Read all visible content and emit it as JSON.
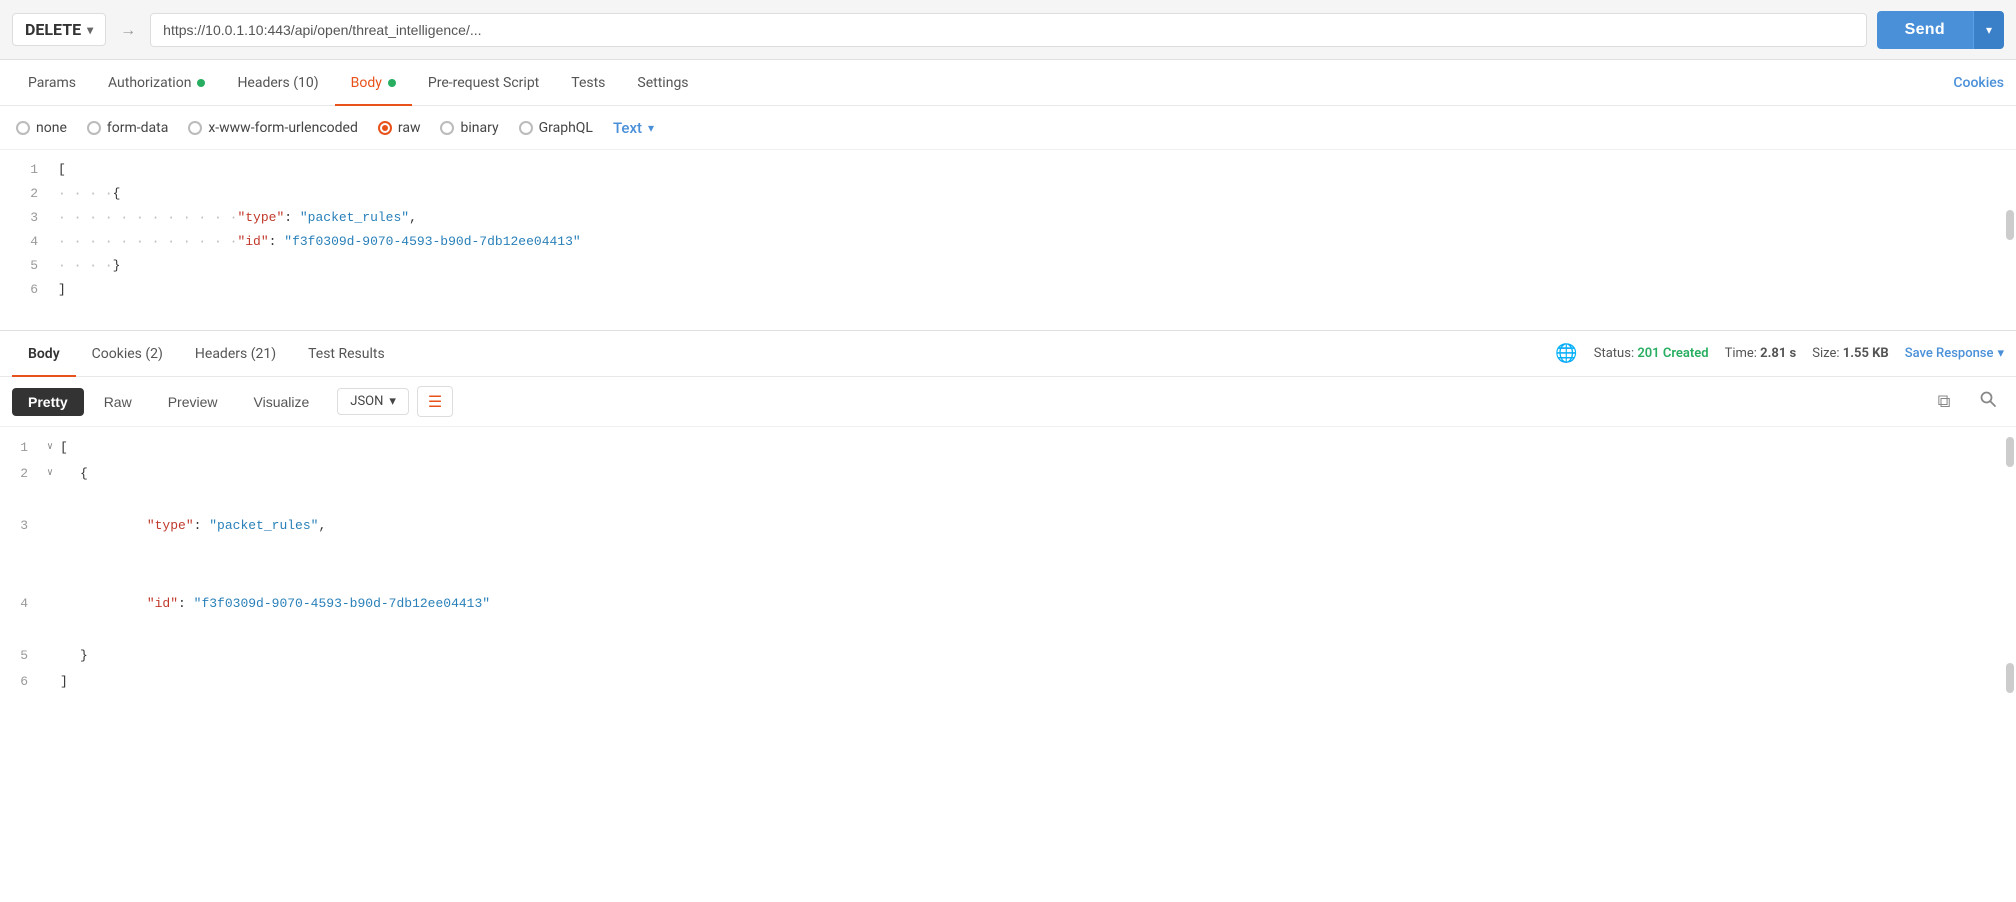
{
  "url_bar": {
    "method": "DELETE",
    "url": "https://10.0.1.10:443/api/open/threat_intelligence/...",
    "send_label": "Send"
  },
  "tabs": {
    "items": [
      {
        "label": "Params",
        "active": false,
        "has_dot": false
      },
      {
        "label": "Authorization",
        "active": false,
        "has_dot": true,
        "dot_color": "green"
      },
      {
        "label": "Headers (10)",
        "active": false,
        "has_dot": false
      },
      {
        "label": "Body",
        "active": true,
        "has_dot": true,
        "dot_color": "green"
      },
      {
        "label": "Pre-request Script",
        "active": false,
        "has_dot": false
      },
      {
        "label": "Tests",
        "active": false,
        "has_dot": false
      },
      {
        "label": "Settings",
        "active": false,
        "has_dot": false
      }
    ],
    "cookies_label": "Cookies"
  },
  "body_type": {
    "options": [
      {
        "id": "none",
        "label": "none",
        "selected": false
      },
      {
        "id": "form-data",
        "label": "form-data",
        "selected": false
      },
      {
        "id": "x-www-form-urlencoded",
        "label": "x-www-form-urlencoded",
        "selected": false
      },
      {
        "id": "raw",
        "label": "raw",
        "selected": true
      },
      {
        "id": "binary",
        "label": "binary",
        "selected": false
      },
      {
        "id": "graphql",
        "label": "GraphQL",
        "selected": false
      }
    ],
    "format_label": "Text",
    "format_chevron": "▾"
  },
  "request_body": {
    "lines": [
      {
        "num": "1",
        "content": "[",
        "type": "bracket"
      },
      {
        "num": "2",
        "content": "    {",
        "type": "bracket"
      },
      {
        "num": "3",
        "content": "        \"type\": \"packet_rules\",",
        "key": "type",
        "value": "packet_rules"
      },
      {
        "num": "4",
        "content": "        \"id\": \"f3f0309d-9070-4593-b90d-7db12ee04413\"",
        "key": "id",
        "value": "f3f0309d-9070-4593-b90d-7db12ee04413"
      },
      {
        "num": "5",
        "content": "    }",
        "type": "bracket"
      },
      {
        "num": "6",
        "content": "]",
        "type": "bracket"
      }
    ]
  },
  "response_header": {
    "tabs": [
      {
        "label": "Body",
        "active": true
      },
      {
        "label": "Cookies (2)",
        "active": false
      },
      {
        "label": "Headers (21)",
        "active": false
      },
      {
        "label": "Test Results",
        "active": false
      }
    ],
    "status_label": "Status:",
    "status_value": "201 Created",
    "time_label": "Time:",
    "time_value": "2.81 s",
    "size_label": "Size:",
    "size_value": "1.55 KB",
    "save_response_label": "Save Response"
  },
  "response_view": {
    "tabs": [
      {
        "label": "Pretty",
        "active": true
      },
      {
        "label": "Raw",
        "active": false
      },
      {
        "label": "Preview",
        "active": false
      },
      {
        "label": "Visualize",
        "active": false
      }
    ],
    "format": "JSON",
    "wrap_icon": "≡",
    "copy_icon": "⧉",
    "search_icon": "🔍"
  },
  "response_body": {
    "lines": [
      {
        "num": "1",
        "collapse": true,
        "indent": 0,
        "content": "["
      },
      {
        "num": "2",
        "collapse": true,
        "indent": 1,
        "content": "{"
      },
      {
        "num": "3",
        "collapse": false,
        "indent": 2,
        "key": "\"type\"",
        "colon": ": ",
        "value": "\"packet_rules\","
      },
      {
        "num": "4",
        "collapse": false,
        "indent": 2,
        "key": "\"id\"",
        "colon": ": ",
        "value": "\"f3f0309d-9070-4593-b90d-7db12ee04413\""
      },
      {
        "num": "5",
        "collapse": false,
        "indent": 1,
        "content": "}"
      },
      {
        "num": "6",
        "collapse": false,
        "indent": 0,
        "content": "]"
      }
    ]
  }
}
